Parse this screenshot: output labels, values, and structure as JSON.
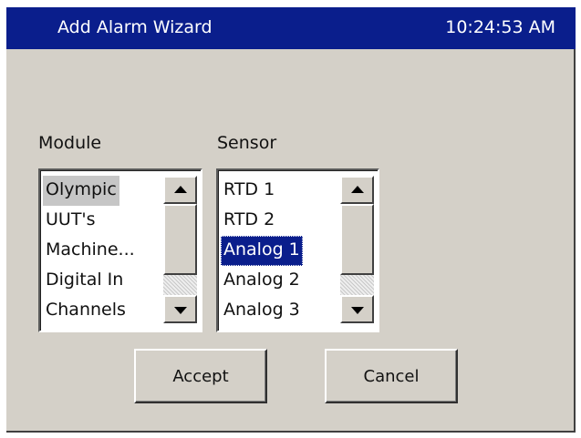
{
  "window": {
    "title": "Add Alarm Wizard",
    "clock": "10:24:53 AM",
    "title_bar_color": "#0a1e8c",
    "background_color": "#d4d0c8"
  },
  "module_list": {
    "label": "Module",
    "items": [
      "Olympic",
      "UUT's",
      "Machine...",
      "Digital In",
      "Channels"
    ],
    "highlighted": "Olympic"
  },
  "sensor_list": {
    "label": "Sensor",
    "items": [
      "RTD 1",
      "RTD 2",
      "Analog 1",
      "Analog 2",
      "Analog 3"
    ],
    "selected": "Analog 1"
  },
  "buttons": {
    "accept_label": "Accept",
    "cancel_label": "Cancel"
  },
  "icons": {
    "scroll_up": "arrow-up-icon",
    "scroll_down": "arrow-down-icon"
  }
}
